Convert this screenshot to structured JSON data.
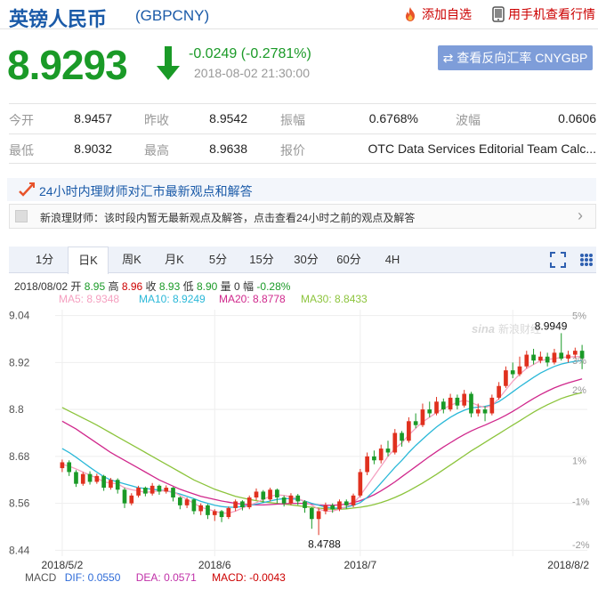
{
  "header": {
    "title": "英镑人民币",
    "code": "(GBPCNY)",
    "add_favorite": "添加自选",
    "mobile_view": "用手机查看行情"
  },
  "quote": {
    "price": "8.9293",
    "change": "-0.0249 (-0.2781%)",
    "timestamp": "2018-08-02 21:30:00",
    "reverse_button": "查看反向汇率 CNYGBP",
    "colors": {
      "down": "#1a9a27",
      "up": "#cc0000",
      "accent": "#1a5aa8"
    }
  },
  "stats": {
    "row1": [
      {
        "label": "今开",
        "value": "8.9457"
      },
      {
        "label": "昨收",
        "value": "8.9542"
      },
      {
        "label": "振幅",
        "value": "0.6768%"
      },
      {
        "label": "波幅",
        "value": "0.0606"
      }
    ],
    "row2": [
      {
        "label": "最低",
        "value": "8.9032"
      },
      {
        "label": "最高",
        "value": "8.9638"
      },
      {
        "label": "报价",
        "value": "OTC Data Services Editorial Team Calc..."
      }
    ]
  },
  "advisor": {
    "title": "24小时内理财师对汇市最新观点和解答",
    "body": "新浪理财师：该时段内暂无最新观点及解答，点击查看24小时之前的观点及解答"
  },
  "tabs": [
    "1分",
    "日K",
    "周K",
    "月K",
    "5分",
    "15分",
    "30分",
    "60分",
    "4H"
  ],
  "active_tab": "日K",
  "ohlc": {
    "date": "2018/08/02",
    "open_label": "开",
    "open": "8.95",
    "high_label": "高",
    "high": "8.96",
    "close_label": "收",
    "close": "8.93",
    "low_label": "低",
    "low": "8.90",
    "vol_label": "量",
    "vol": "0",
    "amp_label": "幅",
    "amp": "-0.28%"
  },
  "ma_legend": {
    "ma5": "MA5: 8.9348",
    "ma10": "MA10: 8.9249",
    "ma20": "MA20: 8.8778",
    "ma30": "MA30: 8.8433"
  },
  "watermark": "新浪财经",
  "macd": {
    "title": "MACD",
    "dif": "DIF: 0.0550",
    "dea": "DEA: 0.0571",
    "macd": "MACD: -0.0043"
  },
  "chart_data": {
    "type": "candlestick",
    "y_ticks": [
      "9.04",
      "8.92",
      "8.8",
      "8.68",
      "8.56",
      "8.44"
    ],
    "y_tick_values": [
      9.04,
      8.92,
      8.8,
      8.68,
      8.56,
      8.44
    ],
    "ylim": [
      8.425,
      9.055
    ],
    "pct_ticks": [
      "5%",
      "3%",
      "2%",
      "1%",
      "-1%",
      "-2%"
    ],
    "x_ticks": [
      "2018/5/2",
      "2018/6",
      "2018/7",
      "2018/8/2"
    ],
    "x_tick_index": [
      0,
      22,
      43,
      65
    ],
    "max_label": "8.9949",
    "min_label": "8.4788",
    "colors": {
      "up": "#e0301e",
      "down": "#1a9a27",
      "ma5": "#f5a0c0",
      "ma10": "#2ab8d8",
      "ma20": "#d0288c",
      "ma30": "#8cc43c"
    },
    "candles": [
      [
        8.65,
        8.665,
        8.672,
        8.64
      ],
      [
        8.665,
        8.64,
        8.67,
        8.63
      ],
      [
        8.64,
        8.61,
        8.645,
        8.602
      ],
      [
        8.61,
        8.635,
        8.64,
        8.605
      ],
      [
        8.635,
        8.615,
        8.642,
        8.608
      ],
      [
        8.615,
        8.63,
        8.636,
        8.61
      ],
      [
        8.63,
        8.6,
        8.633,
        8.592
      ],
      [
        8.6,
        8.62,
        8.625,
        8.595
      ],
      [
        8.62,
        8.595,
        8.624,
        8.585
      ],
      [
        8.595,
        8.56,
        8.6,
        8.548
      ],
      [
        8.56,
        8.58,
        8.586,
        8.555
      ],
      [
        8.58,
        8.6,
        8.605,
        8.575
      ],
      [
        8.6,
        8.585,
        8.603,
        8.578
      ],
      [
        8.585,
        8.605,
        8.612,
        8.58
      ],
      [
        8.605,
        8.59,
        8.608,
        8.582
      ],
      [
        8.59,
        8.6,
        8.606,
        8.585
      ],
      [
        8.6,
        8.575,
        8.602,
        8.565
      ],
      [
        8.575,
        8.555,
        8.578,
        8.545
      ],
      [
        8.555,
        8.57,
        8.575,
        8.548
      ],
      [
        8.57,
        8.54,
        8.572,
        8.532
      ],
      [
        8.54,
        8.555,
        8.56,
        8.53
      ],
      [
        8.555,
        8.53,
        8.558,
        8.52
      ],
      [
        8.53,
        8.54,
        8.545,
        8.515
      ],
      [
        8.54,
        8.525,
        8.543,
        8.512
      ],
      [
        8.525,
        8.548,
        8.552,
        8.52
      ],
      [
        8.548,
        8.565,
        8.57,
        8.54
      ],
      [
        8.565,
        8.55,
        8.568,
        8.542
      ],
      [
        8.55,
        8.575,
        8.58,
        8.545
      ],
      [
        8.575,
        8.59,
        8.598,
        8.568
      ],
      [
        8.59,
        8.57,
        8.594,
        8.562
      ],
      [
        8.57,
        8.595,
        8.6,
        8.565
      ],
      [
        8.595,
        8.575,
        8.598,
        8.56
      ],
      [
        8.575,
        8.56,
        8.58,
        8.552
      ],
      [
        8.56,
        8.58,
        8.586,
        8.555
      ],
      [
        8.58,
        8.565,
        8.584,
        8.556
      ],
      [
        8.565,
        8.548,
        8.568,
        8.536
      ],
      [
        8.548,
        8.52,
        8.55,
        8.495
      ],
      [
        8.52,
        8.54,
        8.548,
        8.479
      ],
      [
        8.54,
        8.555,
        8.562,
        8.532
      ],
      [
        8.555,
        8.545,
        8.56,
        8.536
      ],
      [
        8.545,
        8.565,
        8.57,
        8.54
      ],
      [
        8.565,
        8.555,
        8.57,
        8.546
      ],
      [
        8.555,
        8.58,
        8.585,
        8.55
      ],
      [
        8.58,
        8.64,
        8.648,
        8.575
      ],
      [
        8.64,
        8.68,
        8.69,
        8.632
      ],
      [
        8.68,
        8.67,
        8.695,
        8.66
      ],
      [
        8.67,
        8.7,
        8.71,
        8.662
      ],
      [
        8.7,
        8.69,
        8.72,
        8.68
      ],
      [
        8.69,
        8.74,
        8.75,
        8.685
      ],
      [
        8.74,
        8.72,
        8.745,
        8.705
      ],
      [
        8.72,
        8.77,
        8.78,
        8.715
      ],
      [
        8.77,
        8.76,
        8.79,
        8.752
      ],
      [
        8.76,
        8.8,
        8.815,
        8.755
      ],
      [
        8.8,
        8.79,
        8.82,
        8.78
      ],
      [
        8.79,
        8.82,
        8.832,
        8.785
      ],
      [
        8.82,
        8.8,
        8.828,
        8.79
      ],
      [
        8.8,
        8.83,
        8.84,
        8.795
      ],
      [
        8.83,
        8.81,
        8.838,
        8.8
      ],
      [
        8.81,
        8.84,
        8.85,
        8.805
      ],
      [
        8.84,
        8.79,
        8.845,
        8.78
      ],
      [
        8.79,
        8.8,
        8.815,
        8.782
      ],
      [
        8.8,
        8.79,
        8.808,
        8.77
      ],
      [
        8.79,
        8.83,
        8.838,
        8.785
      ],
      [
        8.83,
        8.86,
        8.87,
        8.825
      ],
      [
        8.86,
        8.9,
        8.91,
        8.855
      ],
      [
        8.9,
        8.89,
        8.92,
        8.88
      ],
      [
        8.89,
        8.91,
        8.935,
        8.885
      ],
      [
        8.91,
        8.94,
        8.95,
        8.905
      ],
      [
        8.94,
        8.925,
        8.955,
        8.915
      ],
      [
        8.925,
        8.935,
        8.948,
        8.918
      ],
      [
        8.935,
        8.92,
        8.945,
        8.91
      ],
      [
        8.92,
        8.945,
        8.955,
        8.915
      ],
      [
        8.945,
        8.93,
        8.995,
        8.925
      ],
      [
        8.93,
        8.94,
        8.95,
        8.92
      ],
      [
        8.94,
        8.95,
        8.958,
        8.93
      ],
      [
        8.95,
        8.93,
        8.965,
        8.903
      ]
    ],
    "ma5": [
      8.66,
      8.655,
      8.648,
      8.64,
      8.632,
      8.625,
      8.615,
      8.612,
      8.61,
      8.6,
      8.595,
      8.592,
      8.588,
      8.59,
      8.592,
      8.592,
      8.59,
      8.58,
      8.57,
      8.56,
      8.55,
      8.545,
      8.54,
      8.535,
      8.535,
      8.54,
      8.548,
      8.555,
      8.562,
      8.57,
      8.578,
      8.582,
      8.58,
      8.577,
      8.572,
      8.565,
      8.555,
      8.545,
      8.54,
      8.54,
      8.545,
      8.552,
      8.56,
      8.58,
      8.605,
      8.63,
      8.655,
      8.68,
      8.7,
      8.715,
      8.735,
      8.752,
      8.768,
      8.78,
      8.792,
      8.802,
      8.81,
      8.818,
      8.824,
      8.818,
      8.81,
      8.805,
      8.81,
      8.828,
      8.85,
      8.872,
      8.89,
      8.905,
      8.915,
      8.925,
      8.928,
      8.93,
      8.933,
      8.934,
      8.935,
      8.935
    ],
    "ma10": [
      8.7,
      8.69,
      8.678,
      8.665,
      8.652,
      8.64,
      8.628,
      8.62,
      8.615,
      8.61,
      8.605,
      8.6,
      8.598,
      8.596,
      8.594,
      8.592,
      8.588,
      8.584,
      8.578,
      8.572,
      8.565,
      8.56,
      8.555,
      8.552,
      8.55,
      8.55,
      8.552,
      8.555,
      8.558,
      8.562,
      8.566,
      8.57,
      8.572,
      8.572,
      8.57,
      8.566,
      8.56,
      8.555,
      8.55,
      8.548,
      8.548,
      8.55,
      8.555,
      8.562,
      8.575,
      8.592,
      8.612,
      8.632,
      8.652,
      8.67,
      8.69,
      8.708,
      8.724,
      8.74,
      8.755,
      8.768,
      8.78,
      8.79,
      8.798,
      8.804,
      8.806,
      8.808,
      8.812,
      8.82,
      8.832,
      8.845,
      8.858,
      8.87,
      8.882,
      8.893,
      8.902,
      8.91,
      8.916,
      8.92,
      8.923,
      8.925
    ],
    "ma20": [
      8.77,
      8.76,
      8.75,
      8.738,
      8.726,
      8.714,
      8.702,
      8.69,
      8.68,
      8.67,
      8.66,
      8.65,
      8.64,
      8.63,
      8.62,
      8.612,
      8.604,
      8.596,
      8.59,
      8.584,
      8.578,
      8.574,
      8.57,
      8.566,
      8.563,
      8.56,
      8.558,
      8.557,
      8.556,
      8.556,
      8.557,
      8.558,
      8.559,
      8.56,
      8.56,
      8.56,
      8.558,
      8.556,
      8.555,
      8.555,
      8.556,
      8.558,
      8.562,
      8.567,
      8.574,
      8.582,
      8.592,
      8.603,
      8.615,
      8.628,
      8.641,
      8.654,
      8.667,
      8.68,
      8.692,
      8.704,
      8.715,
      8.726,
      8.736,
      8.745,
      8.753,
      8.76,
      8.768,
      8.776,
      8.785,
      8.795,
      8.806,
      8.817,
      8.828,
      8.838,
      8.847,
      8.855,
      8.862,
      8.868,
      8.873,
      8.878
    ],
    "ma30": [
      8.805,
      8.796,
      8.787,
      8.778,
      8.769,
      8.76,
      8.75,
      8.74,
      8.73,
      8.72,
      8.71,
      8.7,
      8.69,
      8.68,
      8.67,
      8.66,
      8.65,
      8.64,
      8.63,
      8.62,
      8.612,
      8.604,
      8.596,
      8.59,
      8.584,
      8.578,
      8.574,
      8.57,
      8.567,
      8.564,
      8.562,
      8.56,
      8.558,
      8.556,
      8.554,
      8.552,
      8.55,
      8.548,
      8.546,
      8.545,
      8.545,
      8.546,
      8.548,
      8.55,
      8.553,
      8.557,
      8.562,
      8.568,
      8.575,
      8.583,
      8.592,
      8.602,
      8.612,
      8.623,
      8.634,
      8.646,
      8.658,
      8.67,
      8.682,
      8.694,
      8.705,
      8.716,
      8.727,
      8.738,
      8.749,
      8.76,
      8.771,
      8.782,
      8.793,
      8.803,
      8.812,
      8.82,
      8.828,
      8.834,
      8.839,
      8.843
    ]
  }
}
